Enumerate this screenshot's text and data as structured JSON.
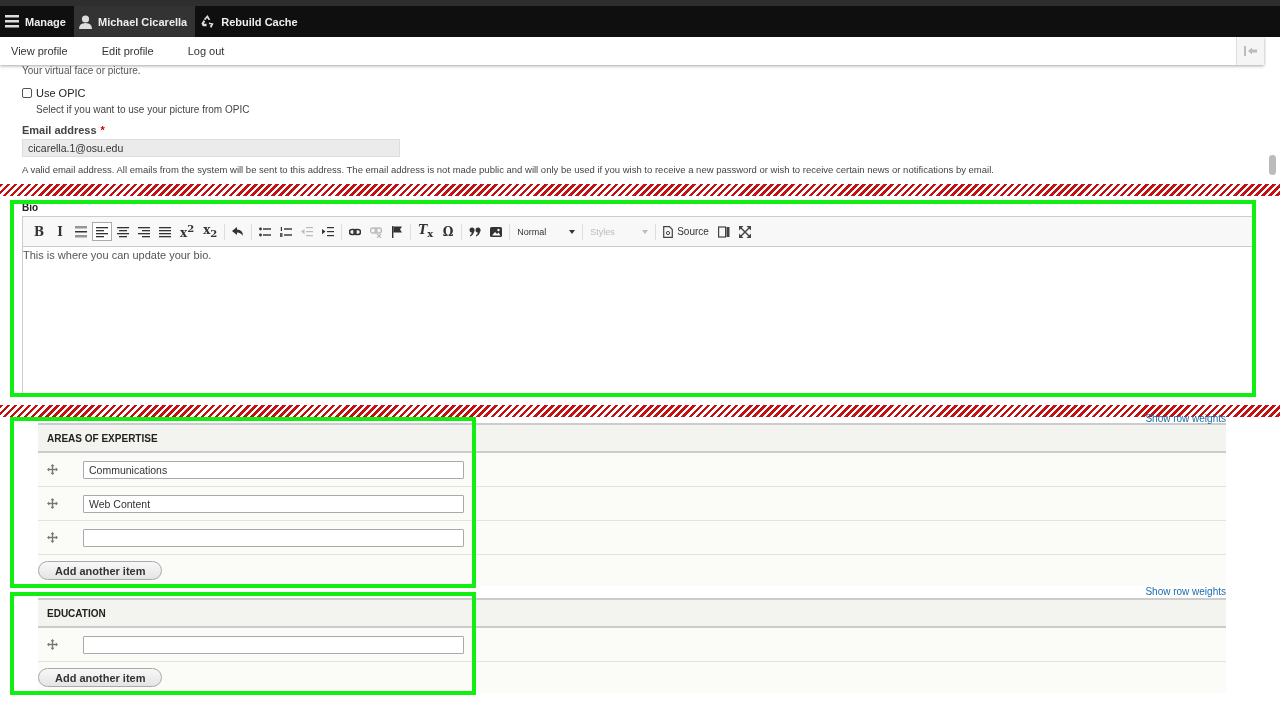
{
  "toolbar": {
    "items": [
      {
        "label": "Manage",
        "kind": "menu",
        "selected": false
      },
      {
        "label": "Michael Cicarella",
        "kind": "user",
        "selected": true
      },
      {
        "label": "Rebuild Cache",
        "kind": "recycle",
        "selected": false
      }
    ]
  },
  "tray": {
    "links": [
      "View profile",
      "Edit profile",
      "Log out"
    ]
  },
  "picture_hint": "Your virtual face or picture.",
  "use_opic": {
    "label": "Use OPIC",
    "checked": false,
    "description": "Select if you want to use your picture from OPIC"
  },
  "email": {
    "label": "Email address",
    "required_marker": "*",
    "value": "cicarella.1@osu.edu",
    "description": "A valid email address. All emails from the system will be sent to this address. The email address is not made public and will only be used if you wish to receive a new password or wish to receive certain news or notifications by email."
  },
  "bio": {
    "label": "Bio",
    "tools": [
      {
        "kind": "glyph",
        "glyph": "B",
        "selected": false,
        "disabled": false
      },
      {
        "kind": "glyph",
        "glyph": "I",
        "selected": false,
        "disabled": false
      },
      {
        "kind": "rule",
        "selected": false,
        "disabled": false
      },
      {
        "kind": "align-left",
        "selected": true,
        "disabled": false
      },
      {
        "kind": "align-center",
        "selected": false,
        "disabled": false
      },
      {
        "kind": "align-right",
        "selected": false,
        "disabled": false
      },
      {
        "kind": "justify",
        "selected": false,
        "disabled": false
      },
      {
        "kind": "glyph",
        "glyph": "x$^{2}$",
        "selected": false,
        "disabled": false
      },
      {
        "kind": "glyph",
        "glyph": "x$_{2}$",
        "selected": false,
        "disabled": false
      },
      {
        "kind": "separator"
      },
      {
        "kind": "undo",
        "selected": false,
        "disabled": false
      },
      {
        "kind": "separator"
      },
      {
        "kind": "bullets",
        "selected": false,
        "disabled": false
      },
      {
        "kind": "numbers",
        "selected": false,
        "disabled": false
      },
      {
        "kind": "outdent",
        "selected": false,
        "disabled": true
      },
      {
        "kind": "indent",
        "selected": false,
        "disabled": false
      },
      {
        "kind": "separator"
      },
      {
        "kind": "link",
        "selected": false,
        "disabled": false
      },
      {
        "kind": "unlink",
        "selected": false,
        "disabled": true
      },
      {
        "kind": "flag",
        "selected": false,
        "disabled": false
      },
      {
        "kind": "separator"
      },
      {
        "kind": "glyph",
        "glyph": "*T*$_{x}$",
        "selected": false,
        "disabled": false
      },
      {
        "kind": "glyph",
        "glyph": "Ω",
        "selected": false,
        "disabled": false
      },
      {
        "kind": "separator"
      },
      {
        "kind": "quote",
        "selected": false,
        "disabled": false
      },
      {
        "kind": "image",
        "selected": false,
        "disabled": false
      },
      {
        "kind": "separator"
      }
    ],
    "dropdowns": [
      {
        "label": "Normal",
        "disabled": false
      },
      {
        "label": "Styles",
        "disabled": true
      }
    ],
    "source": "Source",
    "content": "This is where you can update your bio."
  },
  "multi_fields": [
    {
      "title": "AREAS OF EXPERTISE",
      "show_row_weights": "Show row weights",
      "items": [
        {
          "kind": "filled",
          "value": "Communications"
        },
        {
          "kind": "filled",
          "value": "Web Content"
        },
        {
          "kind": "blank"
        }
      ],
      "add_button": "Add another item"
    },
    {
      "title": "EDUCATION",
      "show_row_weights": "Show row weights",
      "items": [
        {
          "kind": "blank"
        }
      ],
      "add_button": "Add another item"
    }
  ]
}
